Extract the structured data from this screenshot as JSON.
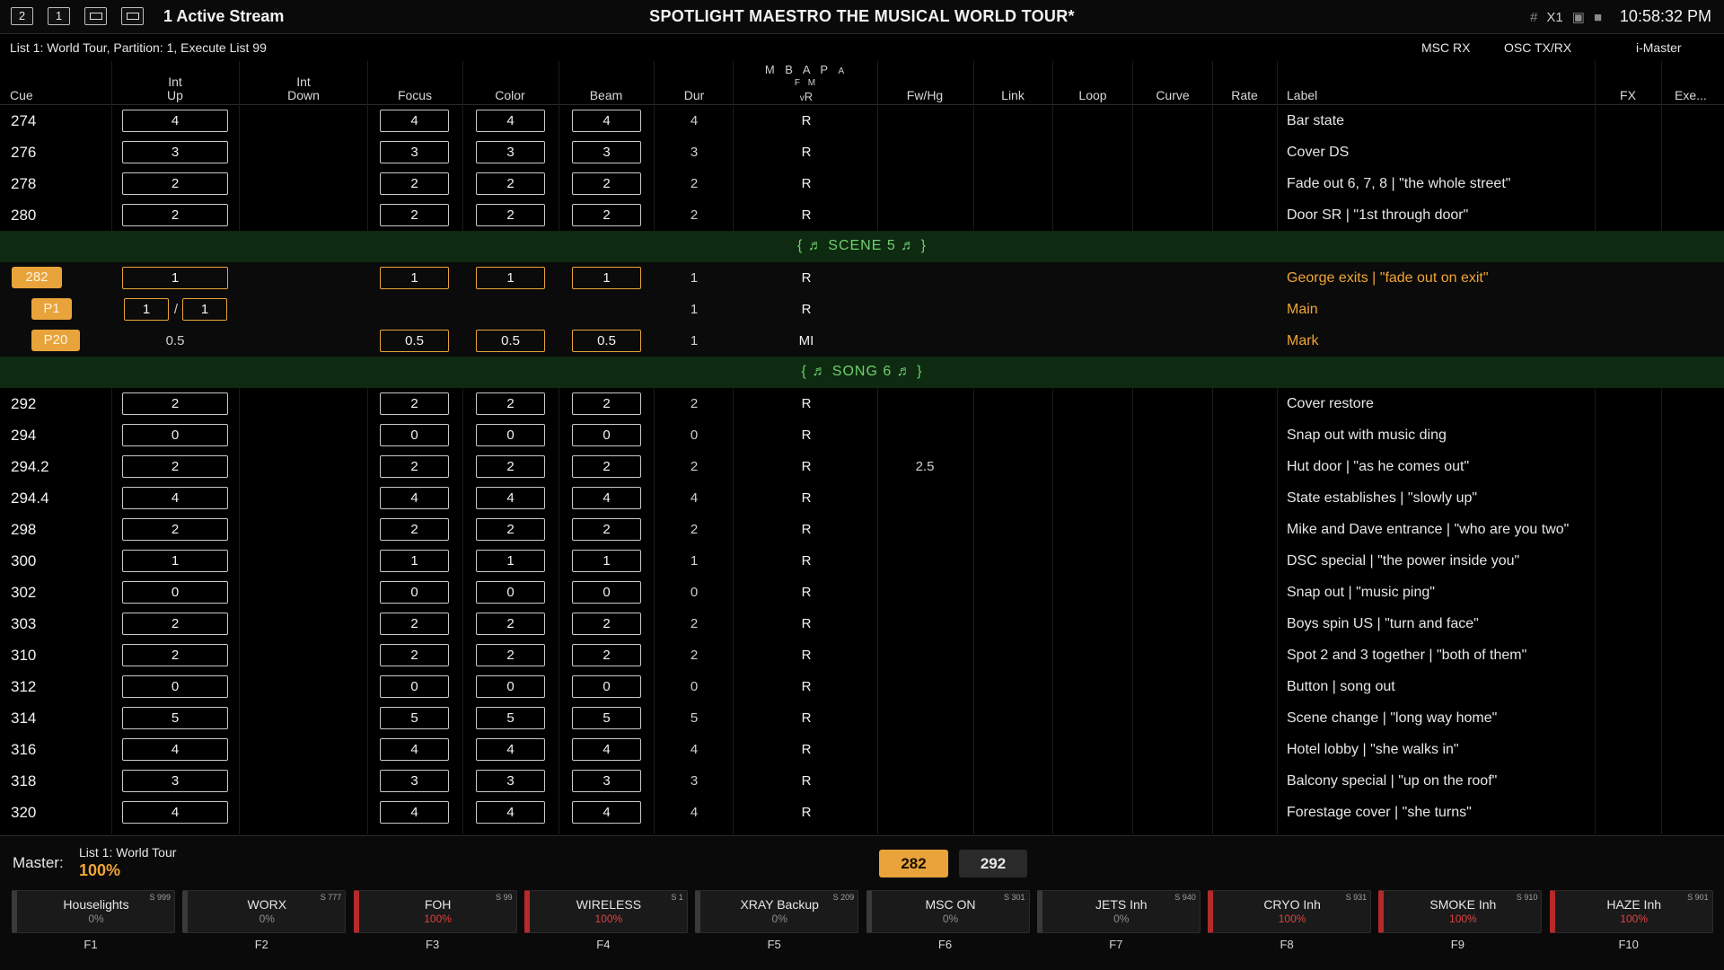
{
  "topbar": {
    "buttons": [
      "2",
      "1"
    ],
    "active_streams": "1 Active Stream",
    "show_title": "SPOTLIGHT MAESTRO  THE MUSICAL  WORLD TOUR*",
    "icons": [
      "grid-icon",
      "x1-indicator",
      "square-icon",
      "stop-icon"
    ],
    "x1_label": "X1",
    "clock": "10:58:32 PM"
  },
  "infoline": {
    "list_info": "List 1: World Tour, Partition: 1, Execute List 99",
    "msc_rx": "MSC RX",
    "osc_txrx": "OSC TX/RX",
    "imaster": "i-Master"
  },
  "columns": {
    "cue": "Cue",
    "int_up_1": "Int",
    "int_up_2": "Up",
    "int_down_1": "Int",
    "int_down_2": "Down",
    "focus": "Focus",
    "color": "Color",
    "beam": "Beam",
    "dur": "Dur",
    "mbap": "M B A P",
    "mbap_small": "A",
    "fm": "F M",
    "vr": "R",
    "vr_small": "v",
    "fwhg": "Fw/Hg",
    "link": "Link",
    "loop": "Loop",
    "curve": "Curve",
    "rate": "Rate",
    "label": "Label",
    "fx": "FX",
    "exe": "Exe..."
  },
  "rows": [
    {
      "type": "cue",
      "cue": "274",
      "up": "4",
      "focus": "4",
      "color": "4",
      "beam": "4",
      "dur": "4",
      "mode": "R",
      "fwhg": "",
      "label": "Bar state"
    },
    {
      "type": "cue",
      "cue": "276",
      "up": "3",
      "focus": "3",
      "color": "3",
      "beam": "3",
      "dur": "3",
      "mode": "R",
      "fwhg": "",
      "label": "Cover DS"
    },
    {
      "type": "cue",
      "cue": "278",
      "up": "2",
      "focus": "2",
      "color": "2",
      "beam": "2",
      "dur": "2",
      "mode": "R",
      "fwhg": "",
      "label": "Fade out 6, 7, 8 | \"the whole street\""
    },
    {
      "type": "cue",
      "cue": "280",
      "up": "2",
      "focus": "2",
      "color": "2",
      "beam": "2",
      "dur": "2",
      "mode": "R",
      "fwhg": "",
      "label": "Door SR | \"1st through door\""
    },
    {
      "type": "scene",
      "text": "{ ♬  SCENE 5  ♬ }"
    },
    {
      "type": "active",
      "cue": "282",
      "up": "1",
      "focus": "1",
      "color": "1",
      "beam": "1",
      "dur": "1",
      "mode": "R",
      "label": "George exits | \"fade out on exit\""
    },
    {
      "type": "part1",
      "cue": "P1",
      "up": "1",
      "down": "1",
      "sep": "/",
      "dur": "1",
      "mode": "R",
      "label": "Main"
    },
    {
      "type": "part2",
      "cue": "P20",
      "up": "0.5",
      "focus": "0.5",
      "color": "0.5",
      "beam": "0.5",
      "dur": "1",
      "mode": "MI",
      "label": "Mark"
    },
    {
      "type": "scene",
      "text": "{ ♬  SONG 6  ♬ }"
    },
    {
      "type": "cue",
      "cue": "292",
      "up": "2",
      "focus": "2",
      "color": "2",
      "beam": "2",
      "dur": "2",
      "mode": "R",
      "fwhg": "",
      "label": "Cover restore"
    },
    {
      "type": "cue",
      "cue": "294",
      "up": "0",
      "focus": "0",
      "color": "0",
      "beam": "0",
      "dur": "0",
      "mode": "R",
      "fwhg": "",
      "label": "Snap out with music ding"
    },
    {
      "type": "cue",
      "cue": "294.2",
      "up": "2",
      "focus": "2",
      "color": "2",
      "beam": "2",
      "dur": "2",
      "mode": "R",
      "fwhg": "2.5",
      "label": "Hut door | \"as he comes out\""
    },
    {
      "type": "cue",
      "cue": "294.4",
      "up": "4",
      "focus": "4",
      "color": "4",
      "beam": "4",
      "dur": "4",
      "mode": "R",
      "fwhg": "",
      "label": "State establishes | \"slowly up\""
    },
    {
      "type": "cue",
      "cue": "298",
      "up": "2",
      "focus": "2",
      "color": "2",
      "beam": "2",
      "dur": "2",
      "mode": "R",
      "fwhg": "",
      "label": "Mike and Dave entrance | \"who are you two\""
    },
    {
      "type": "cue",
      "cue": "300",
      "up": "1",
      "focus": "1",
      "color": "1",
      "beam": "1",
      "dur": "1",
      "mode": "R",
      "fwhg": "",
      "label": "DSC special | \"the power inside you\""
    },
    {
      "type": "cue",
      "cue": "302",
      "up": "0",
      "focus": "0",
      "color": "0",
      "beam": "0",
      "dur": "0",
      "mode": "R",
      "fwhg": "",
      "label": "Snap out | \"music ping\""
    },
    {
      "type": "cue",
      "cue": "303",
      "up": "2",
      "focus": "2",
      "color": "2",
      "beam": "2",
      "dur": "2",
      "mode": "R",
      "fwhg": "",
      "label": "Boys spin US | \"turn and face\""
    },
    {
      "type": "cue",
      "cue": "310",
      "up": "2",
      "focus": "2",
      "color": "2",
      "beam": "2",
      "dur": "2",
      "mode": "R",
      "fwhg": "",
      "label": "Spot 2 and 3 together | \"both of them\""
    },
    {
      "type": "cue",
      "cue": "312",
      "up": "0",
      "focus": "0",
      "color": "0",
      "beam": "0",
      "dur": "0",
      "mode": "R",
      "fwhg": "",
      "label": "Button | song out"
    },
    {
      "type": "cue",
      "cue": "314",
      "up": "5",
      "focus": "5",
      "color": "5",
      "beam": "5",
      "dur": "5",
      "mode": "R",
      "fwhg": "",
      "label": "Scene change | \"long way home\""
    },
    {
      "type": "cue",
      "cue": "316",
      "up": "4",
      "focus": "4",
      "color": "4",
      "beam": "4",
      "dur": "4",
      "mode": "R",
      "fwhg": "",
      "label": "Hotel lobby | \"she walks in\""
    },
    {
      "type": "cue",
      "cue": "318",
      "up": "3",
      "focus": "3",
      "color": "3",
      "beam": "3",
      "dur": "3",
      "mode": "R",
      "fwhg": "",
      "label": "Balcony special | \"up on the roof\""
    },
    {
      "type": "cue",
      "cue": "320",
      "up": "4",
      "focus": "4",
      "color": "4",
      "beam": "4",
      "dur": "4",
      "mode": "R",
      "fwhg": "",
      "label": "Forestage cover | \"she turns\""
    }
  ],
  "bottom": {
    "master_label": "Master:",
    "master_list": "List 1: World Tour",
    "master_pct": "100%",
    "active_cue": "282",
    "next_cue": "292",
    "faders": [
      {
        "name": "Houselights",
        "pct": "0%",
        "sub": "S 999",
        "key": "F1",
        "on": false
      },
      {
        "name": "WORX",
        "pct": "0%",
        "sub": "S 777",
        "key": "F2",
        "on": false
      },
      {
        "name": "FOH",
        "pct": "100%",
        "sub": "S 99",
        "key": "F3",
        "on": true
      },
      {
        "name": "WIRELESS",
        "pct": "100%",
        "sub": "S 1",
        "key": "F4",
        "on": true
      },
      {
        "name": "XRAY Backup",
        "pct": "0%",
        "sub": "S 209",
        "key": "F5",
        "on": false
      },
      {
        "name": "MSC ON",
        "pct": "0%",
        "sub": "S 301",
        "key": "F6",
        "on": false
      },
      {
        "name": "JETS Inh",
        "pct": "0%",
        "sub": "S 940",
        "key": "F7",
        "on": false
      },
      {
        "name": "CRYO Inh",
        "pct": "100%",
        "sub": "S 931",
        "key": "F8",
        "on": true
      },
      {
        "name": "SMOKE Inh",
        "pct": "100%",
        "sub": "S 910",
        "key": "F9",
        "on": true
      },
      {
        "name": "HAZE Inh",
        "pct": "100%",
        "sub": "S 901",
        "key": "F10",
        "on": true
      }
    ]
  },
  "colors": {
    "accent": "#e8a33a",
    "scene_bg": "#0e2a10",
    "scene_text": "#6fd06f",
    "inhibit_red": "#b52a2a"
  }
}
